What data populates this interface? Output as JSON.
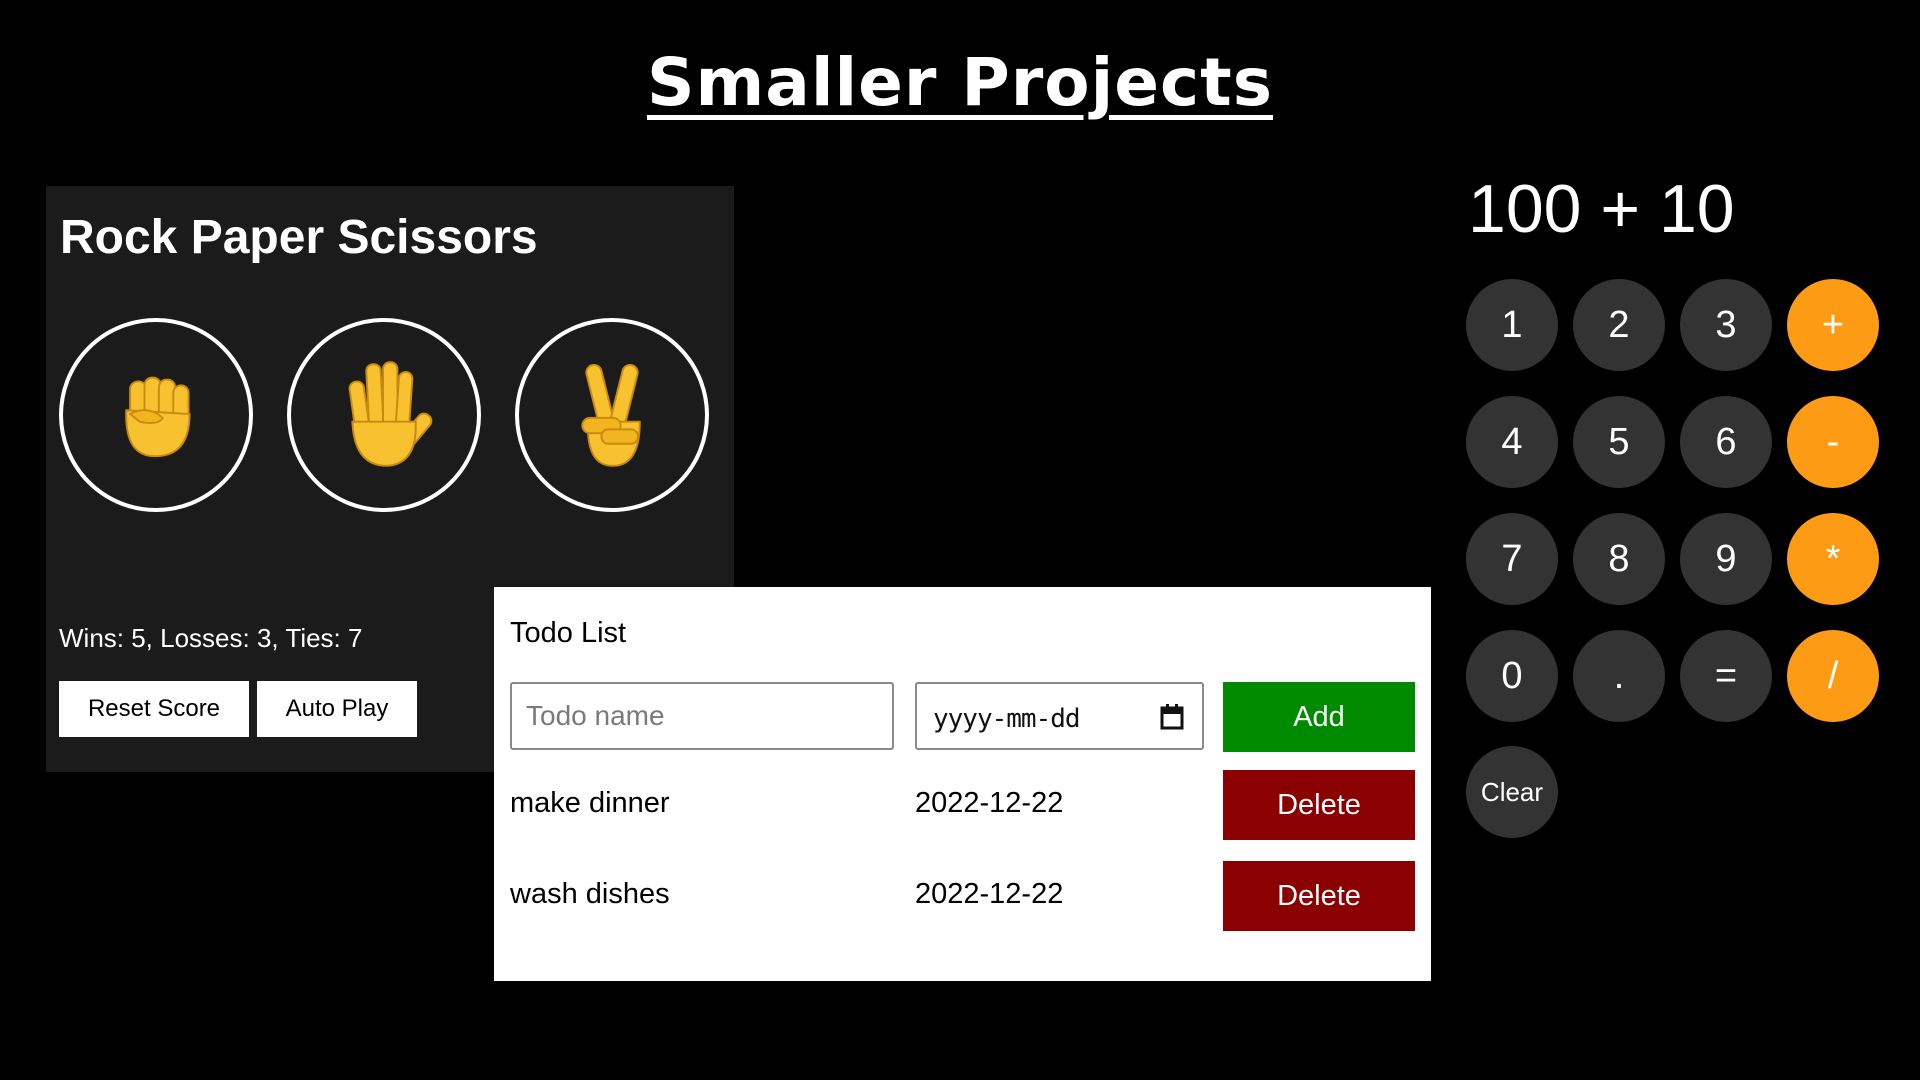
{
  "slide": {
    "title": "Smaller Projects"
  },
  "rps": {
    "title": "Rock Paper Scissors",
    "moves": [
      {
        "name": "rock",
        "icon": "fist-icon"
      },
      {
        "name": "paper",
        "icon": "raised-hand-icon"
      },
      {
        "name": "scissors",
        "icon": "victory-hand-icon"
      }
    ],
    "score_text": "Wins: 5, Losses: 3, Ties: 7",
    "reset_label": "Reset Score",
    "auto_play_label": "Auto Play",
    "colors": {
      "panel": "#1b1b1b",
      "emoji": "#f7c12f"
    }
  },
  "todo": {
    "title": "Todo List",
    "name_placeholder": "Todo name",
    "date_placeholder": "yyyy-mm-dd",
    "add_label": "Add",
    "items": [
      {
        "name": "make dinner",
        "date": "2022-12-22",
        "delete_label": "Delete"
      },
      {
        "name": "wash dishes",
        "date": "2022-12-22",
        "delete_label": "Delete"
      }
    ],
    "colors": {
      "add": "#008a00",
      "delete": "#8b0000"
    }
  },
  "calculator": {
    "display": "100 + 10",
    "keys": [
      [
        "1",
        "2",
        "3",
        "+"
      ],
      [
        "4",
        "5",
        "6",
        "-"
      ],
      [
        "7",
        "8",
        "9",
        "*"
      ],
      [
        "0",
        ".",
        "=",
        "/"
      ],
      [
        "Clear"
      ]
    ],
    "colors": {
      "key": "#333333",
      "operator": "#fe9b14"
    }
  }
}
